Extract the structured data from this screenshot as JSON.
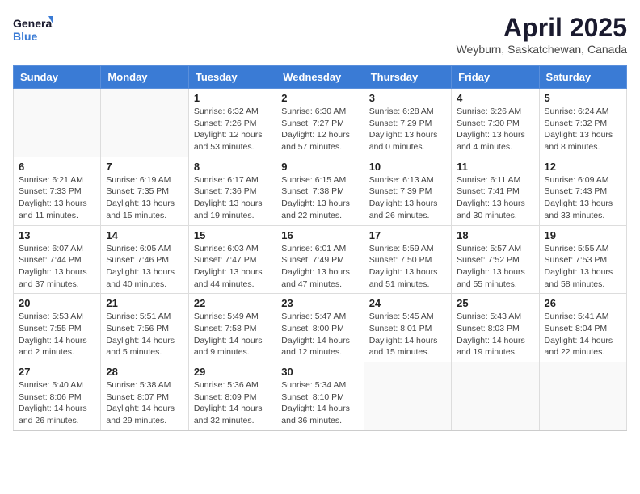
{
  "header": {
    "logo_general": "General",
    "logo_blue": "Blue",
    "month_year": "April 2025",
    "location": "Weyburn, Saskatchewan, Canada"
  },
  "days_of_week": [
    "Sunday",
    "Monday",
    "Tuesday",
    "Wednesday",
    "Thursday",
    "Friday",
    "Saturday"
  ],
  "weeks": [
    [
      {
        "day": "",
        "info": ""
      },
      {
        "day": "",
        "info": ""
      },
      {
        "day": "1",
        "info": "Sunrise: 6:32 AM\nSunset: 7:26 PM\nDaylight: 12 hours and 53 minutes."
      },
      {
        "day": "2",
        "info": "Sunrise: 6:30 AM\nSunset: 7:27 PM\nDaylight: 12 hours and 57 minutes."
      },
      {
        "day": "3",
        "info": "Sunrise: 6:28 AM\nSunset: 7:29 PM\nDaylight: 13 hours and 0 minutes."
      },
      {
        "day": "4",
        "info": "Sunrise: 6:26 AM\nSunset: 7:30 PM\nDaylight: 13 hours and 4 minutes."
      },
      {
        "day": "5",
        "info": "Sunrise: 6:24 AM\nSunset: 7:32 PM\nDaylight: 13 hours and 8 minutes."
      }
    ],
    [
      {
        "day": "6",
        "info": "Sunrise: 6:21 AM\nSunset: 7:33 PM\nDaylight: 13 hours and 11 minutes."
      },
      {
        "day": "7",
        "info": "Sunrise: 6:19 AM\nSunset: 7:35 PM\nDaylight: 13 hours and 15 minutes."
      },
      {
        "day": "8",
        "info": "Sunrise: 6:17 AM\nSunset: 7:36 PM\nDaylight: 13 hours and 19 minutes."
      },
      {
        "day": "9",
        "info": "Sunrise: 6:15 AM\nSunset: 7:38 PM\nDaylight: 13 hours and 22 minutes."
      },
      {
        "day": "10",
        "info": "Sunrise: 6:13 AM\nSunset: 7:39 PM\nDaylight: 13 hours and 26 minutes."
      },
      {
        "day": "11",
        "info": "Sunrise: 6:11 AM\nSunset: 7:41 PM\nDaylight: 13 hours and 30 minutes."
      },
      {
        "day": "12",
        "info": "Sunrise: 6:09 AM\nSunset: 7:43 PM\nDaylight: 13 hours and 33 minutes."
      }
    ],
    [
      {
        "day": "13",
        "info": "Sunrise: 6:07 AM\nSunset: 7:44 PM\nDaylight: 13 hours and 37 minutes."
      },
      {
        "day": "14",
        "info": "Sunrise: 6:05 AM\nSunset: 7:46 PM\nDaylight: 13 hours and 40 minutes."
      },
      {
        "day": "15",
        "info": "Sunrise: 6:03 AM\nSunset: 7:47 PM\nDaylight: 13 hours and 44 minutes."
      },
      {
        "day": "16",
        "info": "Sunrise: 6:01 AM\nSunset: 7:49 PM\nDaylight: 13 hours and 47 minutes."
      },
      {
        "day": "17",
        "info": "Sunrise: 5:59 AM\nSunset: 7:50 PM\nDaylight: 13 hours and 51 minutes."
      },
      {
        "day": "18",
        "info": "Sunrise: 5:57 AM\nSunset: 7:52 PM\nDaylight: 13 hours and 55 minutes."
      },
      {
        "day": "19",
        "info": "Sunrise: 5:55 AM\nSunset: 7:53 PM\nDaylight: 13 hours and 58 minutes."
      }
    ],
    [
      {
        "day": "20",
        "info": "Sunrise: 5:53 AM\nSunset: 7:55 PM\nDaylight: 14 hours and 2 minutes."
      },
      {
        "day": "21",
        "info": "Sunrise: 5:51 AM\nSunset: 7:56 PM\nDaylight: 14 hours and 5 minutes."
      },
      {
        "day": "22",
        "info": "Sunrise: 5:49 AM\nSunset: 7:58 PM\nDaylight: 14 hours and 9 minutes."
      },
      {
        "day": "23",
        "info": "Sunrise: 5:47 AM\nSunset: 8:00 PM\nDaylight: 14 hours and 12 minutes."
      },
      {
        "day": "24",
        "info": "Sunrise: 5:45 AM\nSunset: 8:01 PM\nDaylight: 14 hours and 15 minutes."
      },
      {
        "day": "25",
        "info": "Sunrise: 5:43 AM\nSunset: 8:03 PM\nDaylight: 14 hours and 19 minutes."
      },
      {
        "day": "26",
        "info": "Sunrise: 5:41 AM\nSunset: 8:04 PM\nDaylight: 14 hours and 22 minutes."
      }
    ],
    [
      {
        "day": "27",
        "info": "Sunrise: 5:40 AM\nSunset: 8:06 PM\nDaylight: 14 hours and 26 minutes."
      },
      {
        "day": "28",
        "info": "Sunrise: 5:38 AM\nSunset: 8:07 PM\nDaylight: 14 hours and 29 minutes."
      },
      {
        "day": "29",
        "info": "Sunrise: 5:36 AM\nSunset: 8:09 PM\nDaylight: 14 hours and 32 minutes."
      },
      {
        "day": "30",
        "info": "Sunrise: 5:34 AM\nSunset: 8:10 PM\nDaylight: 14 hours and 36 minutes."
      },
      {
        "day": "",
        "info": ""
      },
      {
        "day": "",
        "info": ""
      },
      {
        "day": "",
        "info": ""
      }
    ]
  ]
}
